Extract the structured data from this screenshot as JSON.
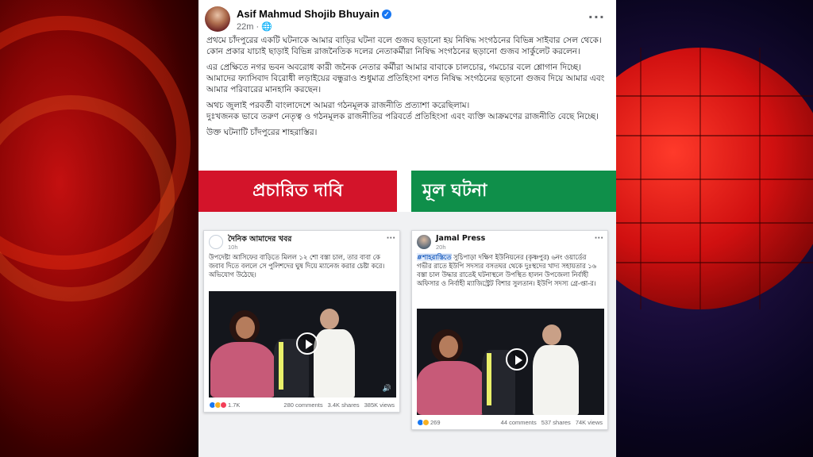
{
  "post": {
    "author": "Asif Mahmud Shojib Bhuyain",
    "time": "22m",
    "privacy_icon": "globe-icon",
    "verified_icon": "verified-badge-icon",
    "more_icon": "more-options-icon",
    "paragraphs": [
      "প্রথমে চাঁদপুরের একটি ঘটনাকে আমার বাড়ির ঘটনা বলে গুজব ছড়ানো হয় নিষিদ্ধ সংগঠনের বিভিন্ন সাইবার সেল থেকে। কোন প্রকার যাচাই ছাড়াই বিভিন্ন রাজনৈতিক দলের নেতাকর্মীরা নিষিদ্ধ সংগঠনের ছড়ানো গুজব সার্কুলেট করলেন।",
      "এর প্রেক্ষিতে নগর ভবন অবরোধ কারী জনৈক নেতার কর্মীরা আমার বাবাকে চালচোর, গমচোর বলে শ্লোগান দিচ্ছে। আমাদের ফ্যাসিবাদ বিরোধী লড়াইয়ের বন্ধুরাও শুধুমাত্র প্রতিহিংসা বশত নিষিদ্ধ সংগঠনের ছড়ানো গুজব দিয়ে আমার এবং আমার পরিবারের মানহানি করছেন।",
      "অথচ জুলাই পরবর্তী বাংলাদেশে আমরা গঠনমূলক রাজনীতি প্রত্যাশা করেছিলাম।",
      "দুঃখজনক ভাবে তরুণ নেতৃত্ব ও গঠনমূলক রাজনীতির পরিবর্তে প্রতিহিংসা এবং ব্যক্তি আক্রমণের রাজনীতি বেছে নিচ্ছে।",
      "উক্ত ঘটনাটি চাঁদপুরের শাহরাস্তির।"
    ]
  },
  "banner": {
    "claim_label": "প্রচারিত দাবি",
    "fact_label": "মূল ঘটনা",
    "claim_color": "#d3142a",
    "fact_color": "#0f8f4a"
  },
  "card_a": {
    "name": "দৈনিক আমাদের খবর",
    "time": "10h",
    "text": "উপদেষ্টা আসিফের বাড়িতে মিলল ১২ শো বস্তা চাল, তার বাবা কে জবাব দিতে বললে সে পুলিশদের ঘুষ দিয়ে ম্যানেজ করার চেষ্টা করে। অভিযোগ উঠেছে।",
    "reactions_count": "1.7K",
    "comments": "280 comments",
    "shares": "3.4K shares",
    "views": "385K views"
  },
  "card_b": {
    "name": "Jamal Press",
    "time": "20h",
    "hashtag": "#শাহরাস্তিতে",
    "text": " সুচিপাড়া দক্ষিণ ইউনিয়নের (কৃষ্ণপুর) ৬নং ওয়ার্ডের গভীর রাতে ইউপি সদস্যর বসতঘর থেকে দুঃস্থদের খাদ্য সহায়তার ১৬ বস্তা চাল উদ্ধার রাতেই ঘটনাস্থলে উপস্থিত হালন উপজেলা নির্বাহী অফিসার ও নির্বাহী ম্যাজিস্ট্রেট বিশার সুলতান। ইউপি সদস্য গ্রে-প্তা-র।",
    "reactions_count": "269",
    "comments": "44 comments",
    "shares": "537 shares",
    "views": "74K views"
  }
}
